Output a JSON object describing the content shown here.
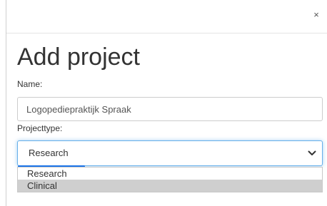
{
  "modal": {
    "close_label": "×",
    "title": "Add project",
    "name_label": "Name:",
    "name_value": "Logopediepraktijk Spraak",
    "type_label": "Projecttype:",
    "type_selected": "Research",
    "type_options": [
      "Research",
      "Clinical"
    ],
    "type_highlighted": "Clinical"
  },
  "colors": {
    "focus_border": "#66afe9",
    "highlight_bg": "#cfcfcf"
  },
  "icons": {
    "close": "close-icon",
    "dropdown": "chevron-down-icon"
  }
}
